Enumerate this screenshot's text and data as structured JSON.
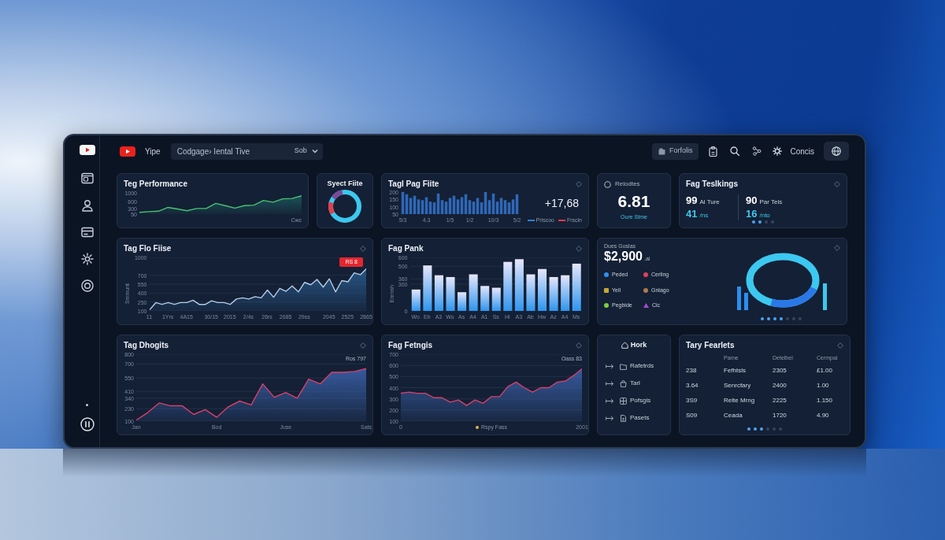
{
  "header": {
    "app_name": "Yipe",
    "selector": {
      "value": "Codgage› Iental Tive",
      "option": "Sob"
    },
    "button": "Forfolis",
    "account": "Concis"
  },
  "cards": [
    {
      "kind": "line_chart",
      "title": "Teg Performance",
      "note": "Cwc",
      "chart_data": {
        "type": "area",
        "ylim": [
          50,
          1000
        ],
        "yticks": [
          1000,
          600,
          300,
          50
        ],
        "series": [
          {
            "color": "#46c46e",
            "values": [
              130,
              160,
              180,
              350,
              280,
              200,
              300,
              300,
              530,
              430,
              320,
              430,
              450,
              660,
              580,
              730,
              750,
              870
            ]
          }
        ]
      }
    },
    {
      "kind": "donut",
      "title": "Syect Fiite"
    },
    {
      "kind": "bar_strip",
      "title": "Tagl Pag Fiite",
      "value": "+17,68",
      "legend": [
        {
          "label": "Prlscoo",
          "color": "#2f7fd0"
        },
        {
          "label": "Frscin",
          "color": "#e04050"
        }
      ],
      "chart_data": {
        "type": "bar",
        "categories": [
          "5/3",
          null,
          null,
          null,
          null,
          null,
          "4.3",
          null,
          null,
          null,
          null,
          null,
          "1/5",
          null,
          null,
          null,
          null,
          "1/2",
          null,
          null,
          null,
          null,
          null,
          "10/3",
          null,
          null,
          null,
          null,
          null,
          "5/2"
        ],
        "values": [
          200,
          185,
          160,
          175,
          150,
          145,
          165,
          135,
          130,
          190,
          145,
          135,
          160,
          175,
          150,
          165,
          185,
          145,
          135,
          160,
          130,
          200,
          145,
          190,
          135,
          160,
          145,
          130,
          150,
          185
        ],
        "ylim": [
          50,
          200
        ],
        "yticks": [
          200,
          150,
          100,
          50
        ]
      }
    },
    {
      "kind": "stat",
      "label": "Relodtes",
      "value": "6.81",
      "caption": "Oure Stme"
    },
    {
      "kind": "pairs",
      "title": "Fag Teslkings",
      "pairs": [
        {
          "number": "99",
          "label": "Al Ture",
          "value": "41",
          "unit": "/ns"
        },
        {
          "number": "90",
          "label": "Par Tels",
          "value": "16",
          "unit": "/nto"
        }
      ],
      "dots": [
        {
          "on": true
        },
        {
          "on": true
        },
        {
          "on": false
        },
        {
          "on": false
        }
      ]
    },
    {
      "kind": "line_chart",
      "title": "Tag Flo Fiise",
      "badge": "RS 8",
      "chart_data": {
        "type": "area",
        "ylabel": "Smmunt",
        "grid": true,
        "categories": [
          "11",
          null,
          null,
          "1Yrs",
          null,
          null,
          "4A15",
          null,
          null,
          null,
          "30/15",
          null,
          null,
          "2015",
          null,
          null,
          "2/4s",
          null,
          null,
          "26rs",
          null,
          null,
          "2685",
          null,
          null,
          "29ss",
          null,
          null,
          null,
          "2045",
          null,
          null,
          "2525",
          null,
          null,
          "2865"
        ],
        "ylim": [
          100,
          1000
        ],
        "yticks": [
          1000,
          700,
          550,
          400,
          250,
          100
        ],
        "series": [
          {
            "color": "#b4cce6",
            "values": [
              120,
              240,
              210,
              240,
              210,
              240,
              240,
              280,
              210,
              210,
              270,
              240,
              240,
              210,
              300,
              320,
              300,
              340,
              320,
              450,
              330,
              480,
              430,
              520,
              420,
              580,
              540,
              630,
              500,
              640,
              420,
              610,
              590,
              740,
              710,
              810
            ]
          }
        ]
      }
    },
    {
      "kind": "bar_chart",
      "title": "Fag Pank",
      "chart_data": {
        "type": "bar",
        "ylabel": "Enrnsh",
        "grid": true,
        "categories": [
          "Wo",
          "Eb",
          "A3",
          "Wo",
          "As",
          "A4",
          "A1",
          "Ss",
          "Hi",
          "A3",
          "Ab",
          "Hw",
          "Az",
          "A4",
          "Ms"
        ],
        "values": [
          240,
          510,
          400,
          380,
          210,
          410,
          280,
          260,
          550,
          580,
          410,
          470,
          380,
          400,
          530
        ],
        "ylim": [
          0,
          600
        ],
        "yticks": [
          600,
          500,
          360,
          300,
          0
        ]
      }
    },
    {
      "kind": "ring_summary",
      "label": "Dues Goslas",
      "value": "$2,900",
      "unit": ".ai",
      "legend": [
        {
          "kind": "dot",
          "label": "Peded",
          "color": "#2f8ff0"
        },
        {
          "kind": "dot",
          "label": "Cerling",
          "color": "#e0405a"
        },
        {
          "kind": "square",
          "label": "Yell",
          "color": "#c9a63a"
        },
        {
          "kind": "dot",
          "label": "Gnlago",
          "color": "#b07a4a"
        },
        {
          "kind": "dot",
          "label": "Pegbide",
          "color": "#7ad03a"
        },
        {
          "kind": "triangle",
          "label": "Cic",
          "color": "#a24ad0"
        }
      ],
      "dots": [
        {
          "on": true
        },
        {
          "on": true
        },
        {
          "on": true
        },
        {
          "on": true
        },
        {
          "on": false
        },
        {
          "on": false
        },
        {
          "on": false
        }
      ]
    },
    {
      "kind": "area_chart",
      "title": "Tag Dhogits",
      "note": "Ros 797",
      "chart_data": {
        "type": "area",
        "grid": true,
        "categories": [
          "Jan",
          null,
          null,
          null,
          null,
          null,
          null,
          "Bod",
          null,
          null,
          null,
          null,
          null,
          "Juse",
          null,
          null,
          null,
          null,
          null,
          null,
          "Sats"
        ],
        "ylim": [
          100,
          800
        ],
        "yticks": [
          800,
          700,
          550,
          410,
          340,
          230,
          100
        ],
        "series": [
          {
            "color": "#d8406a",
            "values": [
              110,
              190,
              290,
              260,
              260,
              170,
              220,
              140,
              250,
              310,
              270,
              490,
              350,
              400,
              340,
              540,
              490,
              610,
              610,
              620,
              650
            ]
          }
        ]
      }
    },
    {
      "kind": "area_chart",
      "title": "Fag Fetngis",
      "note": "Oass 83",
      "legend": "Rspy Fass",
      "chart_data": {
        "type": "area",
        "grid": true,
        "categories": [
          "0",
          null,
          null,
          null,
          null,
          null,
          null,
          null,
          null,
          null,
          null,
          null,
          null,
          null,
          null,
          null,
          null,
          null,
          null,
          null,
          null,
          null,
          "2001"
        ],
        "ylim": [
          100,
          700
        ],
        "yticks": [
          700,
          600,
          500,
          400,
          300,
          200,
          100
        ],
        "series": [
          {
            "color": "#d8406a",
            "values": [
              350,
              360,
              350,
              350,
              310,
              310,
              270,
              290,
              240,
              290,
              260,
              320,
              320,
              410,
              450,
              400,
              360,
              400,
              400,
              450,
              460,
              510,
              570
            ]
          }
        ]
      }
    },
    {
      "kind": "nav_list",
      "title": "Hork",
      "items": [
        "Rafetrds",
        "Tarl",
        "Pofsgis",
        "Pasets"
      ]
    },
    {
      "kind": "table",
      "title": "Tary Fearlets",
      "columns": [
        "",
        "Parne",
        "Detelbel",
        "Cermpal"
      ],
      "rows": [
        [
          "238",
          "Fefhtsls",
          "2305",
          "£1.00"
        ],
        [
          "3.64",
          "Senrcfary",
          "2400",
          "1.00"
        ],
        [
          "3S9",
          "Relte Mrng",
          "2225",
          "1.150"
        ],
        [
          "S09",
          "Ceada",
          "1720",
          "4.90"
        ]
      ],
      "dots": [
        {
          "on": true
        },
        {
          "on": true
        },
        {
          "on": true
        },
        {
          "on": false
        },
        {
          "on": false
        },
        {
          "on": false
        }
      ]
    }
  ]
}
